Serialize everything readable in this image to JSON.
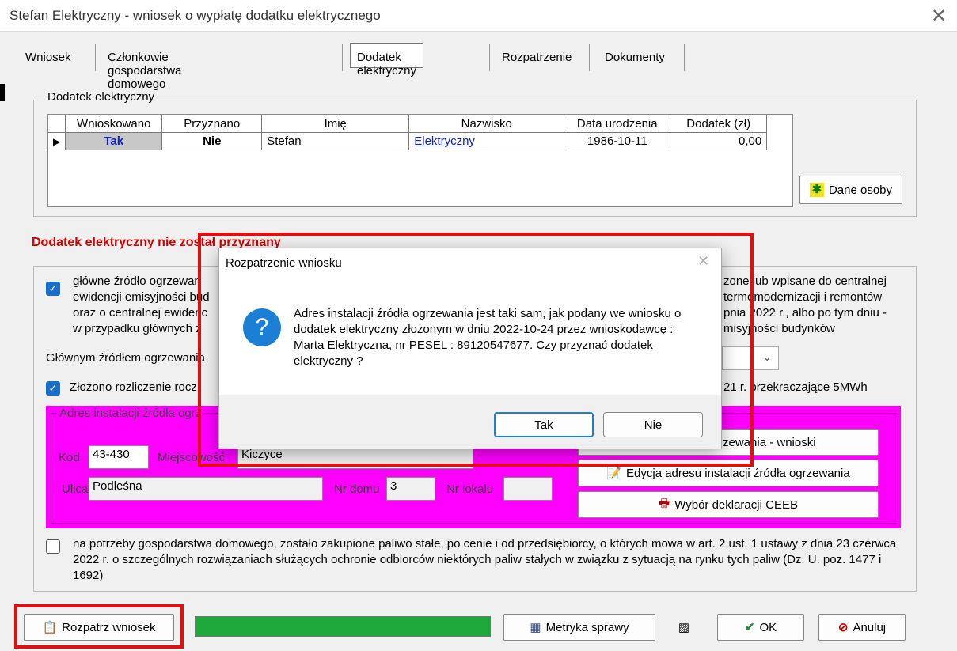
{
  "window": {
    "title": "Stefan Elektryczny - wniosek o wypłatę dodatku elektrycznego",
    "close_glyph": "✕"
  },
  "tabs": [
    "Wniosek",
    "Członkowie gospodarstwa domowego",
    "Dodatek elektryczny",
    "Rozpatrzenie",
    "Dokumenty"
  ],
  "active_tab": "Dodatek elektryczny",
  "dodatek_group": {
    "legend": "Dodatek elektryczny",
    "columns": [
      "Wnioskowano",
      "Przyznano",
      "Imię",
      "Nazwisko",
      "Data urodzenia",
      "Dodatek  (zł)"
    ],
    "row": {
      "wnioskowano": "Tak",
      "przyznano": "Nie",
      "imie": "Stefan",
      "nazwisko": "Elektryczny",
      "data_urodzenia": "1986-10-11",
      "dodatek": "0,00"
    },
    "dane_osoby": "Dane osoby"
  },
  "status_text": "Dodatek elektryczny nie został przyznany",
  "section": {
    "check1_line1_a": "główne źródło ogrzewan",
    "check1_line1_b": "zone lub wpisane do centralnej",
    "check1_line2_a": "ewidencji emisyjności bud",
    "check1_line2_b": "termomodernizacji i remontów",
    "check1_line3_a": "oraz o centralnej ewidenc",
    "check1_line3_b": "pnia 2022 r., albo po tym dniu -",
    "check1_line4_a": "w przypadku głównych ź",
    "check1_line4_b": "misyjności budynków",
    "glowne_label": "Głównym źródłem ogrzewania",
    "check2_a": "Złożono rozliczenie rocz",
    "check2_b": "21 r. przekraczające 5MWh",
    "adres_legend": "Adres instalacji źródła ogrz",
    "kod_label": "Kod",
    "kod_value": "43-430",
    "miejscowosc_label": "Miejscowość",
    "miejscowosc_value": "Kiczyce",
    "ulica_label": "Ulica",
    "ulica_value": "Podleśna",
    "nr_domu_label": "Nr domu",
    "nr_domu_value": "3",
    "nr_lokalu_label": "Nr lokalu",
    "nr_lokalu_value": "",
    "btn_wnioski": "zewania - wnioski",
    "btn_edycja": "Edycja adresu instalacji źródła ogrzewania",
    "btn_ceeb": "Wybór deklaracji CEEB",
    "paliwo_text": "na potrzeby gospodarstwa domowego, zostało zakupione paliwo stałe, po cenie i od przedsiębiorcy, o których mowa w art. 2 ust. 1 ustawy z dnia 23 czerwca 2022 r. o szczególnych rozwiązaniach służących ochronie odbiorców niektórych paliw stałych w związku z sytuacją na rynku tych paliw (Dz. U. poz. 1477 i 1692)"
  },
  "dialog": {
    "title": "Rozpatrzenie wniosku",
    "close_glyph": "✕",
    "icon": "question-icon",
    "message": "Adres instalacji źródła ogrzewania jest taki sam, jak podany we wniosku o dodatek elektryczny złożonym w dniu 2022-10-24 przez wnioskodawcę : Marta Elektryczna, nr PESEL : 89120547677. Czy przyznać dodatek elektryczny ?",
    "yes": "Tak",
    "no": "Nie"
  },
  "footer": {
    "rozpatrz": "Rozpatrz wniosek",
    "progress": 1.0,
    "metryka": "Metryka sprawy",
    "ok": "OK",
    "anuluj": "Anuluj"
  },
  "colors": {
    "accent_red": "#e01010",
    "magenta": "#ff00ff",
    "progress_green": "#1fa83a",
    "link_blue": "#1020c0"
  }
}
